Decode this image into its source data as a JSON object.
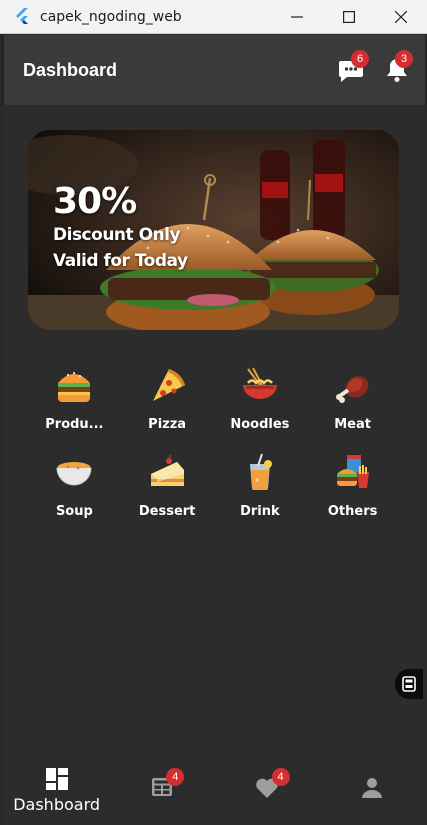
{
  "window": {
    "title": "capek_ngoding_web"
  },
  "appbar": {
    "title": "Dashboard",
    "chat_badge": "6",
    "notification_badge": "3"
  },
  "promo": {
    "headline": "30%",
    "line1": "Discount Only",
    "line2": "Valid for Today"
  },
  "categories": [
    {
      "label": "Produ...",
      "icon": "burger-icon"
    },
    {
      "label": "Pizza",
      "icon": "pizza-icon"
    },
    {
      "label": "Noodles",
      "icon": "noodles-icon"
    },
    {
      "label": "Meat",
      "icon": "meat-icon"
    },
    {
      "label": "Soup",
      "icon": "soup-icon"
    },
    {
      "label": "Dessert",
      "icon": "cake-icon"
    },
    {
      "label": "Drink",
      "icon": "drink-icon"
    },
    {
      "label": "Others",
      "icon": "fastfood-icon"
    }
  ],
  "bottom_nav": {
    "dashboard_label": "Dashboard",
    "orders_badge": "4",
    "favorites_badge": "4"
  },
  "colors": {
    "background": "#2c2c2c",
    "appbar": "#3a3a3a",
    "badge": "#d32f2f"
  }
}
